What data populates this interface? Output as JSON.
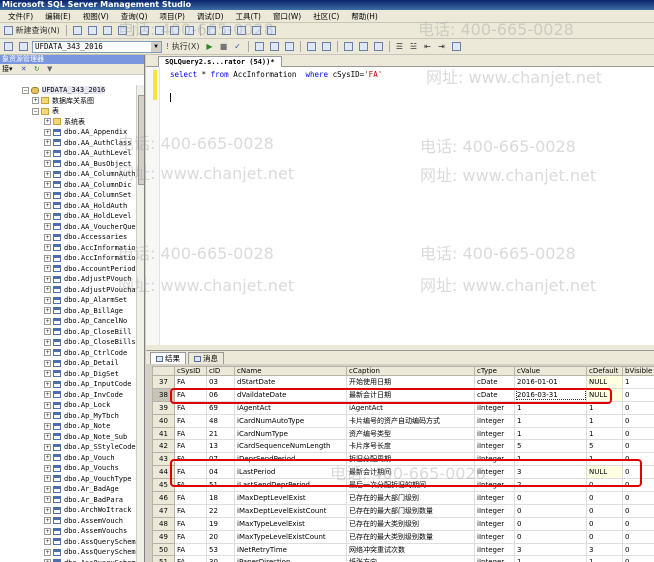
{
  "window": {
    "title": "Microsoft SQL Server Management Studio"
  },
  "menu": [
    "文件(F)",
    "编辑(E)",
    "视图(V)",
    "查询(Q)",
    "项目(P)",
    "调试(D)",
    "工具(T)",
    "窗口(W)",
    "社区(C)",
    "帮助(H)"
  ],
  "toolbar": {
    "new_query_label": "新建查询(N)",
    "database": "UFDATA_343_2016",
    "execute_label": "执行(X)"
  },
  "explorer": {
    "title": "象资源管理器",
    "toolbar_label": "接▾",
    "db_name": "UFDATA_343_2016",
    "diagram_folder": "数据库关系图",
    "tables_folder": "表",
    "system_tables": "系统表",
    "tables": [
      "dbo.AA_Appendix",
      "dbo.AA_AuthClass",
      "dbo.AA_AuthLevel",
      "dbo.AA_BusObject",
      "dbo.AA_ColumnAuth",
      "dbo.AA_ColumnDic",
      "dbo.AA_ColumnSet",
      "dbo.AA_HoldAuth",
      "dbo.AA_HoldLevel",
      "dbo.AA_VoucherQue",
      "dbo.Accessaries",
      "dbo.AccInformatio",
      "dbo.AccInformatio",
      "dbo.AccountPeriod",
      "dbo.AdjustPVouch",
      "dbo.AdjustPVoucha",
      "dbo.Ap_AlarmSet",
      "dbo.Ap_BillAge",
      "dbo.Ap_CancelNo",
      "dbo.Ap_CloseBill",
      "dbo.Ap_CloseBills",
      "dbo.Ap_CtrlCode",
      "dbo.Ap_Detail",
      "dbo.Ap_DigSet",
      "dbo.Ap_InputCode",
      "dbo.Ap_InvCode",
      "dbo.Ap_Lock",
      "dbo.Ap_MyTbch",
      "dbo.Ap_Note",
      "dbo.Ap_Note_Sub",
      "dbo.Ap_SStyleCode",
      "dbo.Ap_Vouch",
      "dbo.Ap_Vouchs",
      "dbo.Ap_VouchType",
      "dbo.Ar_BadAge",
      "dbo.Ar_BadPara",
      "dbo.ArchWoItrack",
      "dbo.AssemVouch",
      "dbo.AssemVouchs",
      "dbo.AssQuerySchem",
      "dbo.AssQuerySchem",
      "dbo.AssQuerySchem"
    ]
  },
  "query_tab": {
    "label": "SQLQuery2.s...rator (54))*"
  },
  "editor": {
    "sql": {
      "kw_select": "select",
      "star": "*",
      "kw_from": "from",
      "table": "AccInformation",
      "kw_where": "where",
      "condition": "cSysID=",
      "value": "'FA'"
    }
  },
  "results": {
    "tabs": [
      "结果",
      "消息"
    ],
    "columns": [
      "cSysID",
      "cID",
      "cName",
      "cCaption",
      "cType",
      "cValue",
      "cDefault",
      "bVisible"
    ],
    "rows": [
      {
        "n": "37",
        "cSysID": "FA",
        "cID": "03",
        "cName": "dStartDate",
        "cCaption": "开始使用日期",
        "cType": "cDate",
        "cValue": "2016-01-01",
        "cDefault": "NULL",
        "bVisible": "1"
      },
      {
        "n": "38",
        "cSysID": "FA",
        "cID": "06",
        "cName": "dVaildateDate",
        "cCaption": "最新会计日期",
        "cType": "cDate",
        "cValue": "2016-03-31",
        "cDefault": "NULL",
        "bVisible": "0"
      },
      {
        "n": "39",
        "cSysID": "FA",
        "cID": "69",
        "cName": "iAgentAct",
        "cCaption": "iAgentAct",
        "cType": "iInteger",
        "cValue": "1",
        "cDefault": "1",
        "bVisible": "0"
      },
      {
        "n": "40",
        "cSysID": "FA",
        "cID": "48",
        "cName": "iCardNumAutoType",
        "cCaption": "卡片编号的资产自动编码方式",
        "cType": "iInteger",
        "cValue": "1",
        "cDefault": "1",
        "bVisible": "0"
      },
      {
        "n": "41",
        "cSysID": "FA",
        "cID": "21",
        "cName": "iCardNumType",
        "cCaption": "资产编号类型",
        "cType": "iInteger",
        "cValue": "1",
        "cDefault": "1",
        "bVisible": "0"
      },
      {
        "n": "42",
        "cSysID": "FA",
        "cID": "13",
        "cName": "iCardSequenceNumLength",
        "cCaption": "卡片序号长度",
        "cType": "iInteger",
        "cValue": "5",
        "cDefault": "5",
        "bVisible": "0"
      },
      {
        "n": "43",
        "cSysID": "FA",
        "cID": "07",
        "cName": "iDeprSendPeriod",
        "cCaption": "折旧分配周期",
        "cType": "iInteger",
        "cValue": "1",
        "cDefault": "1",
        "bVisible": "0"
      },
      {
        "n": "44",
        "cSysID": "FA",
        "cID": "04",
        "cName": "iLastPeriod",
        "cCaption": "最新会计期间",
        "cType": "iInteger",
        "cValue": "3",
        "cDefault": "NULL",
        "bVisible": "0"
      },
      {
        "n": "45",
        "cSysID": "FA",
        "cID": "51",
        "cName": "iLastSendDeprPeriod",
        "cCaption": "最后一次分配折旧的期间",
        "cType": "iInteger",
        "cValue": "2",
        "cDefault": "0",
        "bVisible": "0"
      },
      {
        "n": "46",
        "cSysID": "FA",
        "cID": "18",
        "cName": "iMaxDeptLevelExist",
        "cCaption": "已存在的最大部门级别",
        "cType": "iInteger",
        "cValue": "0",
        "cDefault": "0",
        "bVisible": "0"
      },
      {
        "n": "47",
        "cSysID": "FA",
        "cID": "22",
        "cName": "iMaxDeptLevelExistCount",
        "cCaption": "已存在的最大部门级别数量",
        "cType": "iInteger",
        "cValue": "0",
        "cDefault": "0",
        "bVisible": "0"
      },
      {
        "n": "48",
        "cSysID": "FA",
        "cID": "19",
        "cName": "iMaxTypeLevelExist",
        "cCaption": "已存在的最大类别级别",
        "cType": "iInteger",
        "cValue": "0",
        "cDefault": "0",
        "bVisible": "0"
      },
      {
        "n": "49",
        "cSysID": "FA",
        "cID": "20",
        "cName": "iMaxTypeLevelExistCount",
        "cCaption": "已存在的最大类别级别数量",
        "cType": "iInteger",
        "cValue": "0",
        "cDefault": "0",
        "bVisible": "0"
      },
      {
        "n": "50",
        "cSysID": "FA",
        "cID": "53",
        "cName": "iNetRetryTime",
        "cCaption": "网络冲突重试次数",
        "cType": "iInteger",
        "cValue": "3",
        "cDefault": "3",
        "bVisible": "0"
      },
      {
        "n": "51",
        "cSysID": "FA",
        "cID": "30",
        "cName": "iPaperDirection",
        "cCaption": "纸张方向",
        "cType": "iInteger",
        "cValue": "1",
        "cDefault": "1",
        "bVisible": "0"
      }
    ]
  },
  "watermark": {
    "phone": "电话: 400-665-0028",
    "site": "网址: www.chanjet.net"
  },
  "colors": {
    "highlight_box": "#e00000",
    "keyword": "#0000ff",
    "string": "#c00000"
  }
}
